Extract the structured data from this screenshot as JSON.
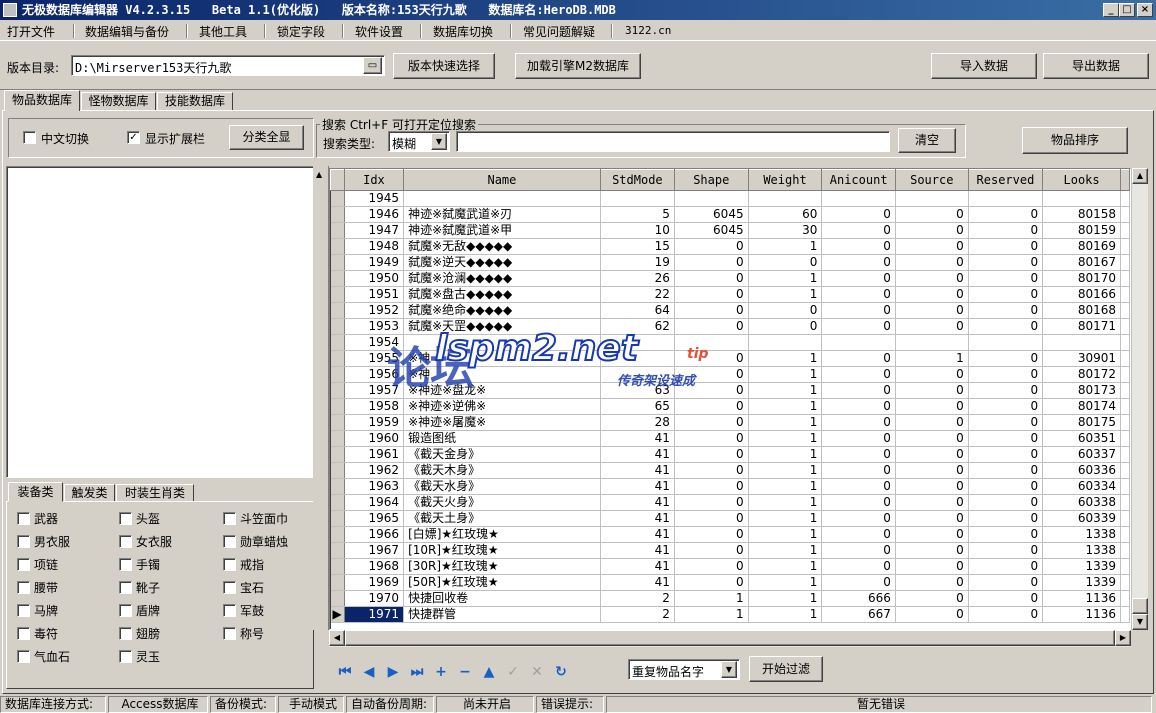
{
  "window": {
    "title": "无极数据库编辑器 V4.2.3.15   Beta 1.1(优化版)   版本名称:153天行九歌   数据库名:HeroDB.MDB",
    "min": "_",
    "max": "□",
    "close": "×"
  },
  "menu": [
    "打开文件",
    "数据编辑与备份",
    "其他工具",
    "锁定字段",
    "软件设置",
    "数据库切换",
    "常见问题解疑",
    "3122.cn"
  ],
  "toolbar": {
    "dir_label": "版本目录:",
    "dir_value": "D:\\Mirserver153天行九歌",
    "quick_select": "版本快速选择",
    "load_engine": "加载引擎M2数据库",
    "import": "导入数据",
    "export": "导出数据"
  },
  "tabs": [
    "物品数据库",
    "怪物数据库",
    "技能数据库"
  ],
  "options": {
    "chinese_switch": "中文切换",
    "show_ext": "显示扩展栏",
    "show_ext_checked": "✓",
    "show_all": "分类全显",
    "item_sort": "物品排序"
  },
  "search": {
    "group_title": "搜索  Ctrl+F 可打开定位搜索",
    "type_label": "搜索类型:",
    "type_value": "模糊",
    "query": "",
    "clear": "清空"
  },
  "category_tabs": [
    "装备类",
    "触发类",
    "时装生肖类"
  ],
  "categories": [
    [
      "武器",
      "头盔",
      "斗笠面巾"
    ],
    [
      "男衣服",
      "女衣服",
      "勋章蜡烛"
    ],
    [
      "项链",
      "手镯",
      "戒指"
    ],
    [
      "腰带",
      "靴子",
      "宝石"
    ],
    [
      "马牌",
      "盾牌",
      "军鼓"
    ],
    [
      "毒符",
      "翅膀",
      "称号"
    ],
    [
      "气血石",
      "灵玉",
      ""
    ]
  ],
  "grid": {
    "columns": [
      "Idx",
      "Name",
      "StdMode",
      "Shape",
      "Weight",
      "Anicount",
      "Source",
      "Reserved",
      "Looks"
    ],
    "rows": [
      [
        "1945",
        "",
        "",
        "",
        "",
        "",
        "",
        "",
        ""
      ],
      [
        "1946",
        "神迹※弑魔武道※刃",
        "5",
        "6045",
        "60",
        "0",
        "0",
        "0",
        "80158"
      ],
      [
        "1947",
        "神迹※弑魔武道※甲",
        "10",
        "6045",
        "30",
        "0",
        "0",
        "0",
        "80159"
      ],
      [
        "1948",
        "弑魔※无敌◆◆◆◆◆",
        "15",
        "0",
        "1",
        "0",
        "0",
        "0",
        "80169"
      ],
      [
        "1949",
        "弑魔※逆天◆◆◆◆◆",
        "19",
        "0",
        "0",
        "0",
        "0",
        "0",
        "80167"
      ],
      [
        "1950",
        "弑魔※沧澜◆◆◆◆◆",
        "26",
        "0",
        "1",
        "0",
        "0",
        "0",
        "80170"
      ],
      [
        "1951",
        "弑魔※盘古◆◆◆◆◆",
        "22",
        "0",
        "1",
        "0",
        "0",
        "0",
        "80166"
      ],
      [
        "1952",
        "弑魔※绝命◆◆◆◆◆",
        "64",
        "0",
        "0",
        "0",
        "0",
        "0",
        "80168"
      ],
      [
        "1953",
        "弑魔※天罡◆◆◆◆◆",
        "62",
        "0",
        "0",
        "0",
        "0",
        "0",
        "80171"
      ],
      [
        "1954",
        "",
        "",
        "",
        "",
        "",
        "",
        "",
        ""
      ],
      [
        "1955",
        "※神",
        "",
        "0",
        "1",
        "0",
        "1",
        "0",
        "30901"
      ],
      [
        "1956",
        "※神",
        "",
        "0",
        "1",
        "0",
        "0",
        "0",
        "80172"
      ],
      [
        "1957",
        "※神迹※盘龙※",
        "63",
        "0",
        "1",
        "0",
        "0",
        "0",
        "80173"
      ],
      [
        "1958",
        "※神迹※逆佛※",
        "65",
        "0",
        "1",
        "0",
        "0",
        "0",
        "80174"
      ],
      [
        "1959",
        "※神迹※屠魔※",
        "28",
        "0",
        "1",
        "0",
        "0",
        "0",
        "80175"
      ],
      [
        "1960",
        "锻造图纸",
        "41",
        "0",
        "1",
        "0",
        "0",
        "0",
        "60351"
      ],
      [
        "1961",
        "《截天金身》",
        "41",
        "0",
        "1",
        "0",
        "0",
        "0",
        "60337"
      ],
      [
        "1962",
        "《截天木身》",
        "41",
        "0",
        "1",
        "0",
        "0",
        "0",
        "60336"
      ],
      [
        "1963",
        "《截天水身》",
        "41",
        "0",
        "1",
        "0",
        "0",
        "0",
        "60334"
      ],
      [
        "1964",
        "《截天火身》",
        "41",
        "0",
        "1",
        "0",
        "0",
        "0",
        "60338"
      ],
      [
        "1965",
        "《截天土身》",
        "41",
        "0",
        "1",
        "0",
        "0",
        "0",
        "60339"
      ],
      [
        "1966",
        "[白嫖]★红玫瑰★",
        "41",
        "0",
        "1",
        "0",
        "0",
        "0",
        "1338"
      ],
      [
        "1967",
        "[10R]★红玫瑰★",
        "41",
        "0",
        "1",
        "0",
        "0",
        "0",
        "1338"
      ],
      [
        "1968",
        "[30R]★红玫瑰★",
        "41",
        "0",
        "1",
        "0",
        "0",
        "0",
        "1339"
      ],
      [
        "1969",
        "[50R]★红玫瑰★",
        "41",
        "0",
        "1",
        "0",
        "0",
        "0",
        "1339"
      ],
      [
        "1970",
        "快捷回收卷",
        "2",
        "1",
        "1",
        "666",
        "0",
        "0",
        "1136"
      ],
      [
        "1971",
        "快捷群管",
        "2",
        "1",
        "1",
        "667",
        "0",
        "0",
        "1136"
      ]
    ],
    "selected_row": 26
  },
  "watermark": {
    "main": "lspm2.net",
    "sub": "论坛",
    "tip": "tip",
    "slogan": "传奇架设速成"
  },
  "bottom": {
    "filter_value": "重复物品名字",
    "start_filter": "开始过滤"
  },
  "status": [
    "数据库连接方式:",
    "Access数据库",
    "备份模式:",
    "手动模式",
    "自动备份周期:",
    "尚未开启",
    "错误提示:",
    "暂无错误"
  ]
}
